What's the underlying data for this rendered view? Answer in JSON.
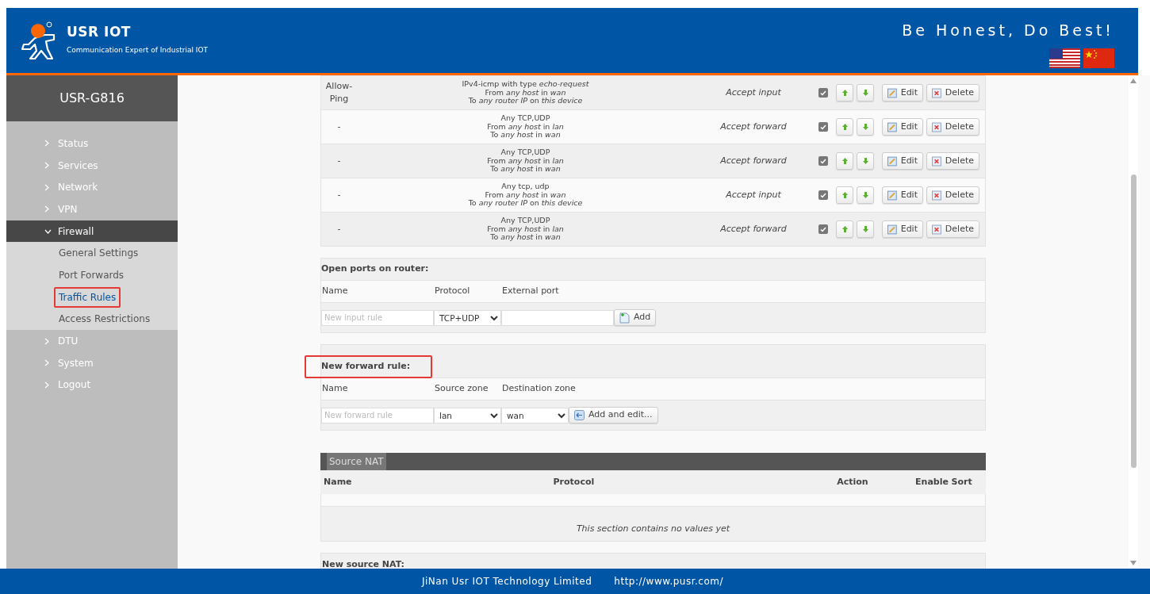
{
  "header": {
    "brand": "USR IOT",
    "tagline": "Communication Expert of Industrial IOT",
    "slogan": "Be Honest, Do Best!"
  },
  "sidebar": {
    "title": "USR-G816",
    "items": [
      {
        "label": "Status",
        "expanded": false
      },
      {
        "label": "Services",
        "expanded": false
      },
      {
        "label": "Network",
        "expanded": false
      },
      {
        "label": "VPN",
        "expanded": false
      },
      {
        "label": "Firewall",
        "expanded": true,
        "children": [
          {
            "label": "General Settings",
            "selected": false,
            "highlighted": false
          },
          {
            "label": "Port Forwards",
            "selected": false,
            "highlighted": false
          },
          {
            "label": "Traffic Rules",
            "selected": true,
            "highlighted": true
          },
          {
            "label": "Access Restrictions",
            "selected": false,
            "highlighted": false
          }
        ]
      },
      {
        "label": "DTU",
        "expanded": false
      },
      {
        "label": "System",
        "expanded": false
      },
      {
        "label": "Logout",
        "expanded": false
      }
    ]
  },
  "rules": [
    {
      "name": "Allow-Ping",
      "match": [
        "IPv4-icmp with type *echo-request*",
        "From *any host* in *wan*",
        "To *any router IP* on *this device*"
      ],
      "action": "Accept input",
      "enabled": true,
      "edit": "Edit",
      "delete": "Delete"
    },
    {
      "name": "-",
      "match": [
        "Any TCP,UDP",
        "From *any host* in *lan*",
        "To *any host* in *wan*"
      ],
      "action": "Accept forward",
      "enabled": true,
      "edit": "Edit",
      "delete": "Delete"
    },
    {
      "name": "-",
      "match": [
        "Any TCP,UDP",
        "From *any host* in *lan*",
        "To *any host* in *wan*"
      ],
      "action": "Accept forward",
      "enabled": true,
      "edit": "Edit",
      "delete": "Delete"
    },
    {
      "name": "-",
      "match": [
        "Any tcp, udp",
        "From *any host* in *wan*",
        "To *any router IP* on *this device*"
      ],
      "action": "Accept input",
      "enabled": true,
      "edit": "Edit",
      "delete": "Delete"
    },
    {
      "name": "-",
      "match": [
        "Any TCP,UDP",
        "From *any host* in *lan*",
        "To *any host* in *wan*"
      ],
      "action": "Accept forward",
      "enabled": true,
      "edit": "Edit",
      "delete": "Delete"
    }
  ],
  "open_ports": {
    "heading": "Open ports on router:",
    "highlighted": false,
    "columns": [
      "Name",
      "Protocol",
      "External port"
    ],
    "name_placeholder": "New input rule",
    "protocol": "TCP+UDP",
    "button": "Add"
  },
  "forward": {
    "heading": "New forward rule:",
    "highlighted": true,
    "columns": [
      "Name",
      "Source zone",
      "Destination zone"
    ],
    "name_placeholder": "New forward rule",
    "source": "lan",
    "destination": "wan",
    "button": "Add and edit..."
  },
  "source_nat": {
    "title": "Source NAT",
    "columns": [
      "Name",
      "Protocol",
      "Action",
      "Enable",
      "Sort"
    ],
    "empty": "This section contains no values yet",
    "next_heading": "New source NAT:"
  },
  "footer": {
    "company": "JiNan Usr IOT Technology Limited",
    "url": "http://www.pusr.com/"
  }
}
